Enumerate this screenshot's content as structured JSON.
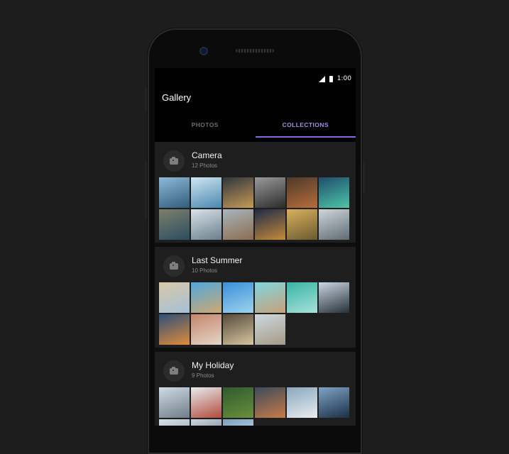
{
  "status_bar": {
    "time": "1:00"
  },
  "app": {
    "title": "Gallery"
  },
  "tabs": [
    {
      "label": "PHOTOS",
      "active": false
    },
    {
      "label": "COLLECTIONS",
      "active": true
    }
  ],
  "colors": {
    "accent": "#8b63e8",
    "background": "#1d1d1d",
    "card": "#1e1e1e"
  },
  "albums": [
    {
      "title": "Camera",
      "count_label": "12 Photos",
      "icon": "camera-icon",
      "thumbs": [
        [
          "#8fb9d8",
          "#2e5d7a"
        ],
        [
          "#cfe6f2",
          "#4a87b0"
        ],
        [
          "#30353c",
          "#c79a58"
        ],
        [
          "#9a9a9a",
          "#2b2b2b"
        ],
        [
          "#4c3a2a",
          "#b86d3b"
        ],
        [
          "#1e4d6b",
          "#4ec6a8"
        ],
        [
          "#7d7f6b",
          "#2a4e61"
        ],
        [
          "#d9e3ea",
          "#6b7f8c"
        ],
        [
          "#a9b5bd",
          "#8a6d4f"
        ],
        [
          "#1f2b4a",
          "#c58a3a"
        ],
        [
          "#d8b05c",
          "#6a5a30"
        ],
        [
          "#cfd6dc",
          "#5f6b73"
        ]
      ]
    },
    {
      "title": "Last Summer",
      "count_label": "10 Photos",
      "icon": "camera-icon",
      "thumbs": [
        [
          "#d9c9a8",
          "#a4c0d6"
        ],
        [
          "#4fa7e0",
          "#d0a970"
        ],
        [
          "#3a8fd8",
          "#9ed3ee"
        ],
        [
          "#7fd7dd",
          "#c9a07a"
        ],
        [
          "#39b3a6",
          "#a7e2d8"
        ],
        [
          "#c9d7e3",
          "#263038"
        ],
        [
          "#2c4f7a",
          "#e28b3b"
        ],
        [
          "#c6856b",
          "#e3d7c9"
        ],
        [
          "#554a3a",
          "#d6c7a0"
        ],
        [
          "#cfd8de",
          "#a49a88"
        ]
      ]
    },
    {
      "title": "My Holiday",
      "count_label": "9 Photos",
      "icon": "camera-icon",
      "thumbs": [
        [
          "#cfdbe6",
          "#6f7c89"
        ],
        [
          "#e7ecef",
          "#b24a3a"
        ],
        [
          "#2f5a2f",
          "#6a8f3c"
        ],
        [
          "#3b4b5b",
          "#c87a4a"
        ],
        [
          "#8aa6bd",
          "#e9eef1"
        ],
        [
          "#7fa3c6",
          "#1b2f45"
        ],
        [
          "#d6dfe6",
          "#8896a3"
        ],
        [
          "#c9d6e0",
          "#5a6b78"
        ],
        [
          "#7ba0bf",
          "#e4ecf1"
        ]
      ]
    }
  ]
}
